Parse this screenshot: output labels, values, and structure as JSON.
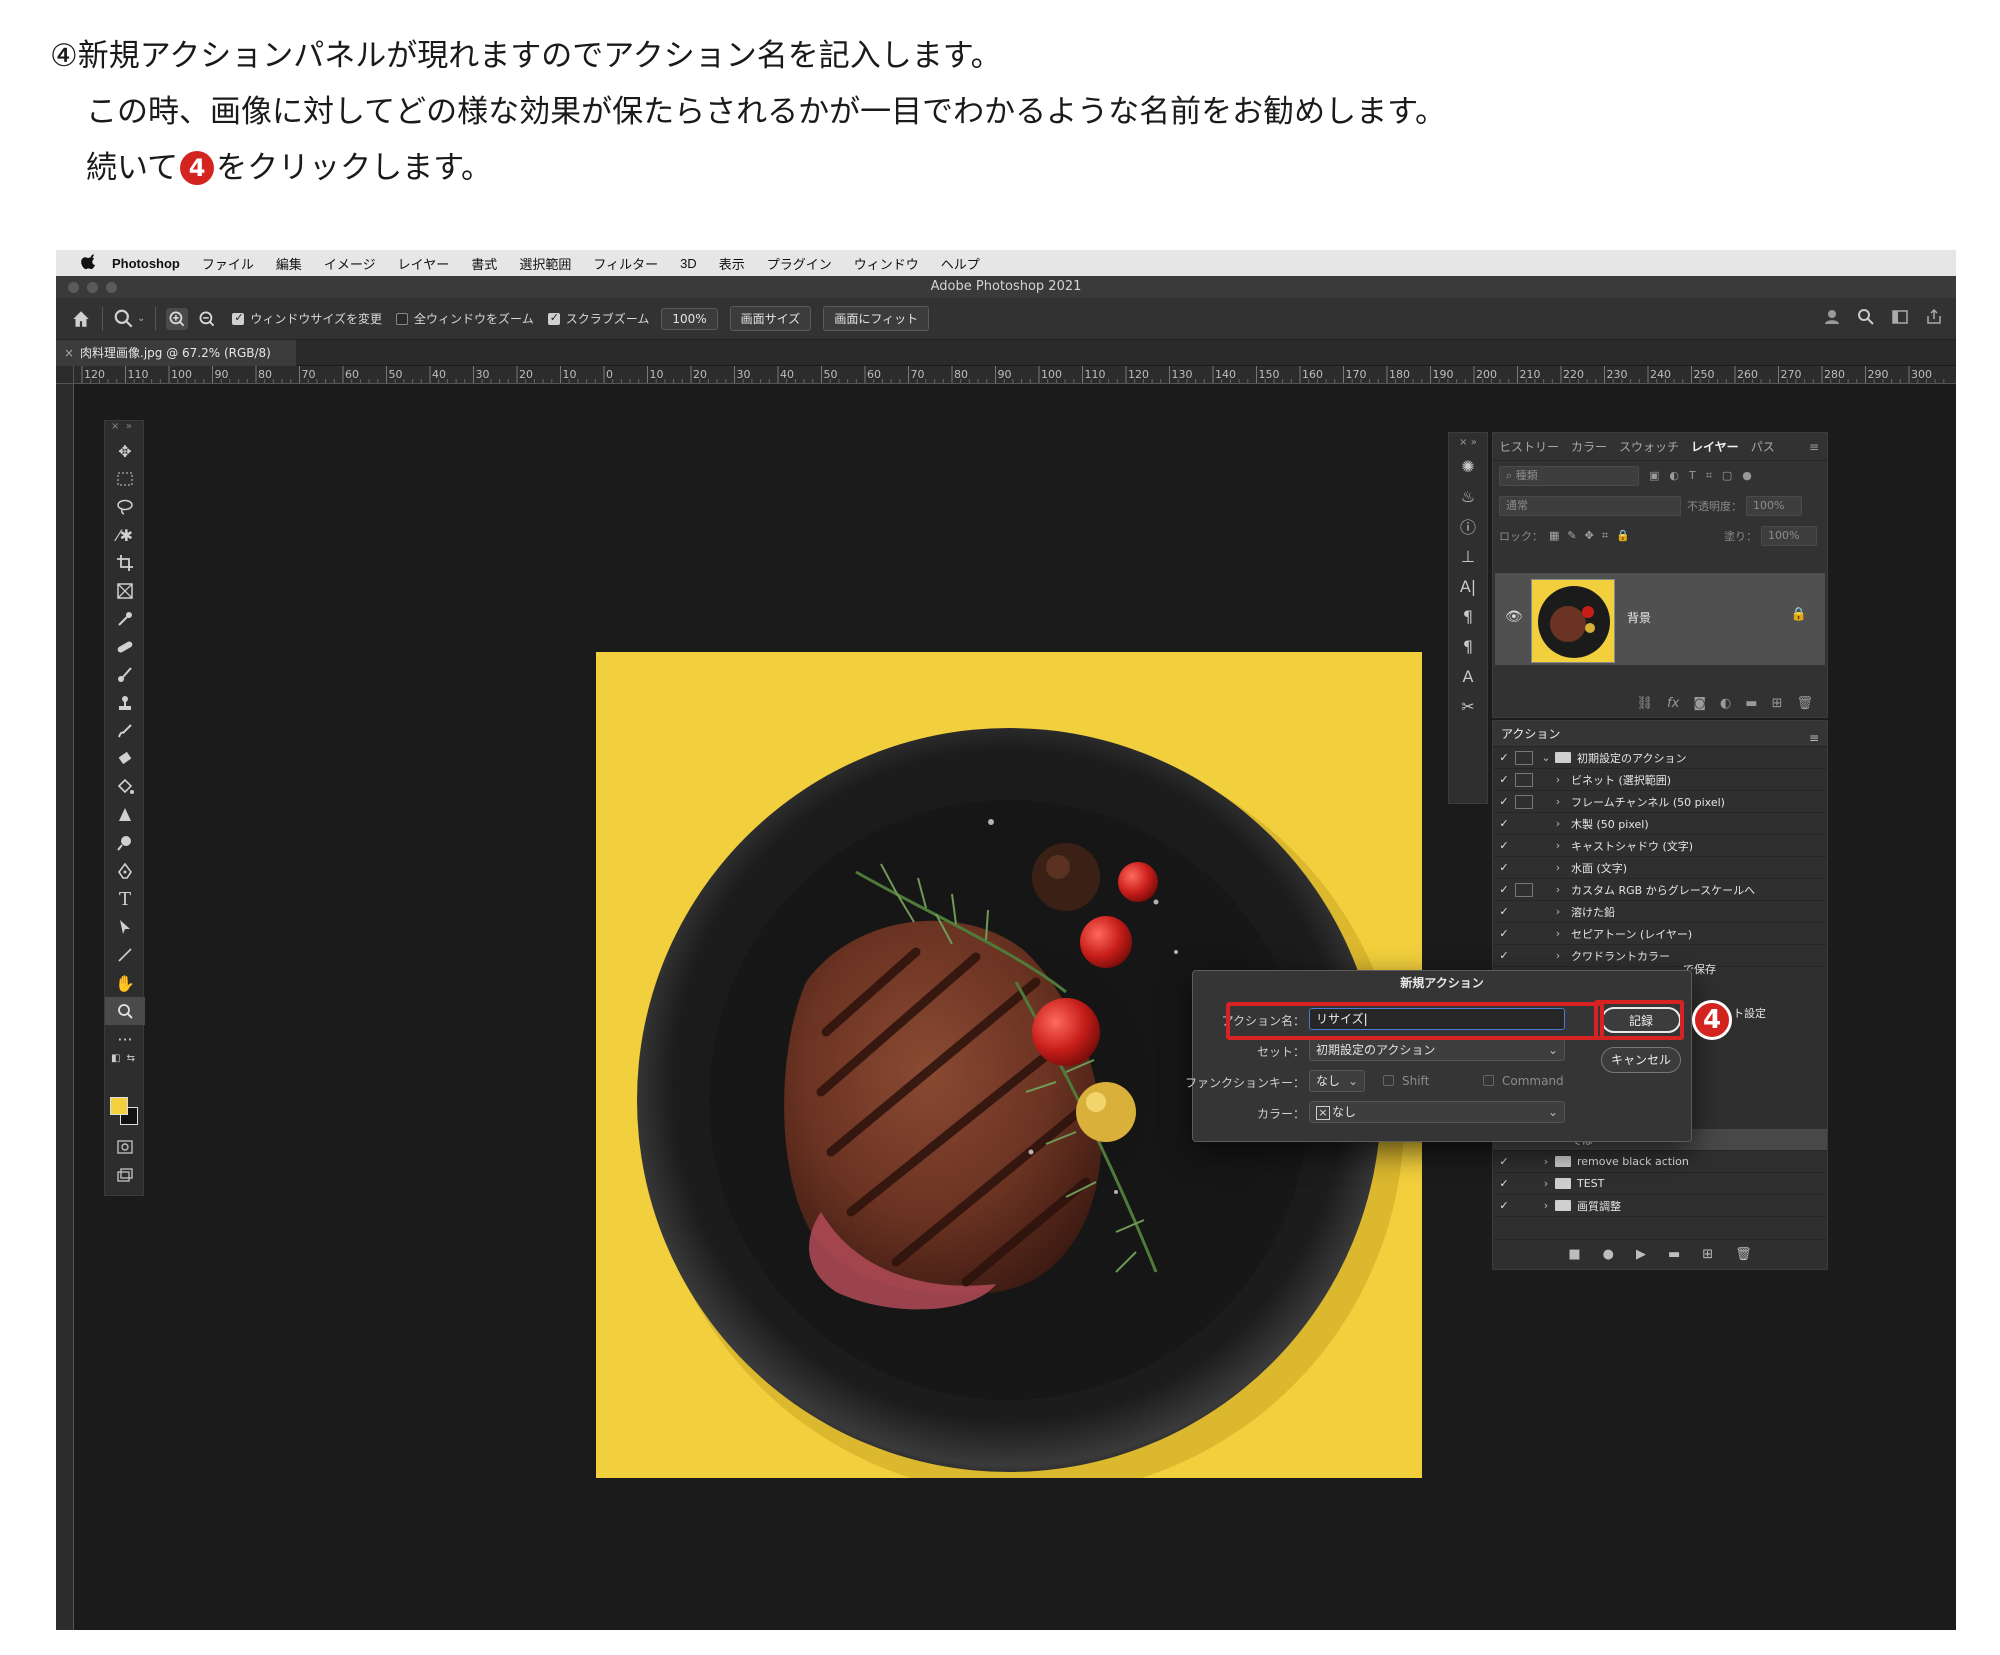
{
  "instructions": {
    "line1": "④新規アクションパネルが現れますのでアクション名を記入します。",
    "line2": "この時、画像に対してどの様な効果が保たらされるかが一目でわかるような名前をお勧めします。",
    "line3_before": "続いて",
    "line3_badge": "4",
    "line3_after": "をクリックします。"
  },
  "menubar": {
    "app": "Photoshop",
    "items": [
      "ファイル",
      "編集",
      "イメージ",
      "レイヤー",
      "書式",
      "選択範囲",
      "フィルター",
      "3D",
      "表示",
      "プラグイン",
      "ウィンドウ",
      "ヘルプ"
    ]
  },
  "window_title": "Adobe Photoshop 2021",
  "optionsbar": {
    "resize_windows": "ウィンドウサイズを変更",
    "zoom_all": "全ウィンドウをズーム",
    "scrubby_zoom": "スクラブズーム",
    "zoom_value": "100%",
    "fit_screen_size": "画面サイズ",
    "fit_screen": "画面にフィット"
  },
  "document_tab": "肉料理画像.jpg @ 67.2% (RGB/8)",
  "ruler_ticks": [
    "120",
    "110",
    "100",
    "90",
    "80",
    "70",
    "60",
    "50",
    "40",
    "30",
    "20",
    "10",
    "0",
    "10",
    "20",
    "30",
    "40",
    "50",
    "60",
    "70",
    "80",
    "90",
    "100",
    "110",
    "120",
    "130",
    "140",
    "150",
    "160",
    "170",
    "180",
    "190",
    "200",
    "210",
    "220",
    "230",
    "240",
    "250",
    "260",
    "270",
    "280",
    "290",
    "300"
  ],
  "layers_panel": {
    "tabs": [
      "ヒストリー",
      "カラー",
      "スウォッチ",
      "レイヤー",
      "パス"
    ],
    "active_tab": "レイヤー",
    "search_placeholder": "種類",
    "blend_mode": "通常",
    "opacity_label": "不透明度：",
    "opacity_value": "100%",
    "lock_label": "ロック：",
    "fill_label": "塗り：",
    "fill_value": "100%",
    "layer_name": "背景"
  },
  "actions_panel": {
    "title": "アクション",
    "rows": [
      {
        "label": "初期設定のアクション",
        "folder": true,
        "expanded": true,
        "dialog": true
      },
      {
        "label": "ビネット (選択範囲)",
        "folder": false,
        "dialog": true
      },
      {
        "label": "フレームチャンネル (50 pixel)",
        "folder": false,
        "dialog": true
      },
      {
        "label": "木製 (50 pixel)",
        "folder": false,
        "dialog": false
      },
      {
        "label": "キャストシャドウ (文字)",
        "folder": false,
        "dialog": false
      },
      {
        "label": "水面 (文字)",
        "folder": false,
        "dialog": false
      },
      {
        "label": "カスタム RGB からグレースケールへ",
        "folder": false,
        "dialog": true
      },
      {
        "label": "溶けた鉛",
        "folder": false,
        "dialog": false
      },
      {
        "label": "セピアトーン (レイヤー)",
        "folder": false,
        "dialog": false
      },
      {
        "label": "クワドラントカラー",
        "folder": false,
        "dialog": false
      }
    ],
    "partial_row_1": "で保存",
    "partial_row_2": "ト設定",
    "bottom_rows": [
      {
        "label": "でば",
        "folder": false,
        "selected": true
      },
      {
        "label": "remove black action",
        "folder": true
      },
      {
        "label": "TEST",
        "folder": true
      },
      {
        "label": "画質調整",
        "folder": true
      }
    ]
  },
  "dialog": {
    "title": "新規アクション",
    "name_label": "アクション名：",
    "name_value": "リサイズ",
    "set_label": "セット：",
    "set_value": "初期設定のアクション",
    "fkey_label": "ファンクションキー：",
    "fkey_value": "なし",
    "shift_label": "Shift",
    "command_label": "Command",
    "color_label": "カラー：",
    "color_value": "なし",
    "record_button": "記録",
    "cancel_button": "キャンセル",
    "badge": "4"
  },
  "colors": {
    "canvas_yellow": "#f2cf3c",
    "highlight_red": "#d62222"
  }
}
